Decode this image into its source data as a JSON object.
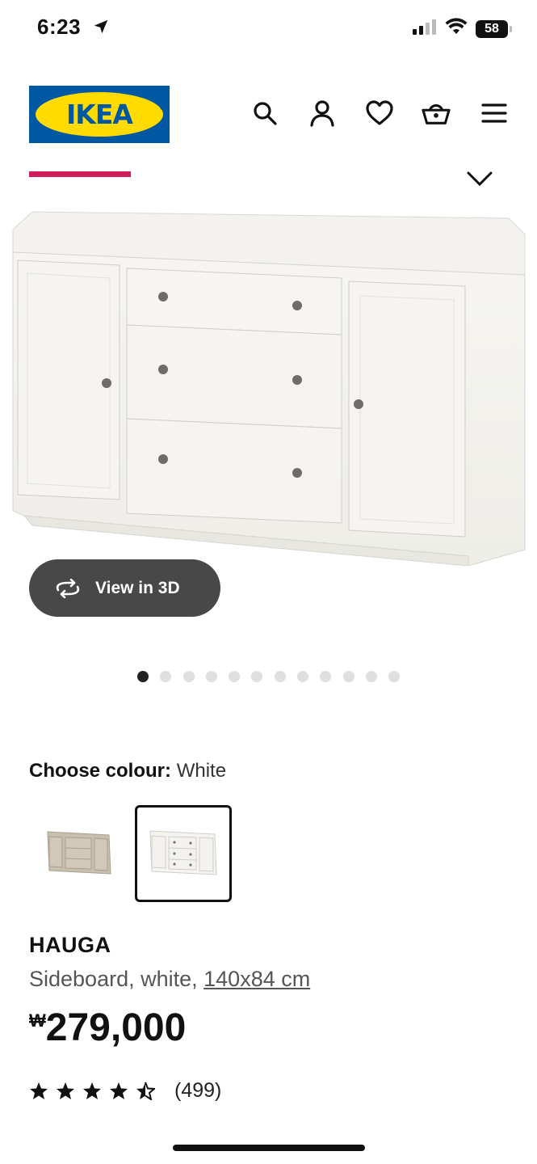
{
  "status_bar": {
    "time": "6:23",
    "battery": "58"
  },
  "header": {
    "logo_text": "IKEA",
    "icons": [
      "search-icon",
      "account-icon",
      "heart-icon",
      "basket-icon",
      "menu-icon"
    ]
  },
  "gallery": {
    "view_3d_label": "View in 3D",
    "image_count": 12,
    "active_index": 0
  },
  "colour": {
    "label": "Choose colour:",
    "selected": "White",
    "options": [
      "Grey-beige",
      "White"
    ]
  },
  "product": {
    "name": "HAUGA",
    "description": "Sideboard, white, ",
    "size": "140x84 cm",
    "currency": "₩",
    "price": "279,000",
    "rating": 4.5,
    "review_count": "(499)"
  },
  "colors": {
    "accent": "#d01c5a",
    "ikea_blue": "#0058a3",
    "ikea_yellow": "#ffdb00",
    "button_bg": "#484848"
  }
}
